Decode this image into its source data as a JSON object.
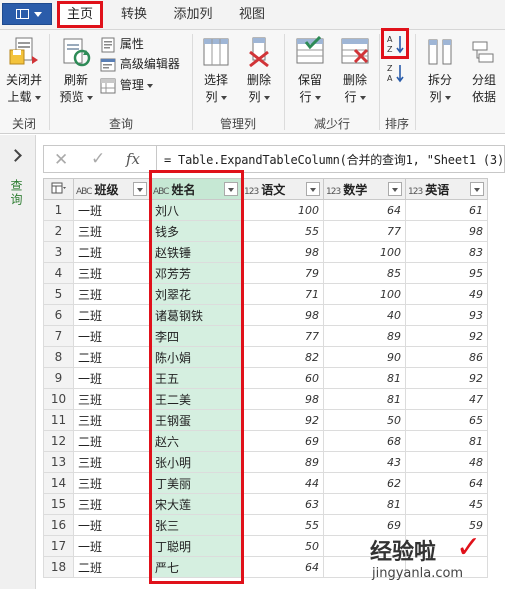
{
  "file_menu": {
    "icon": "menu-icon"
  },
  "tabs": [
    {
      "label": "主页"
    },
    {
      "label": "转换"
    },
    {
      "label": "添加列"
    },
    {
      "label": "视图"
    }
  ],
  "ribbon": {
    "close_load": {
      "line1": "关闭并",
      "line2": "上载"
    },
    "refresh": {
      "line1": "刷新",
      "line2": "预览"
    },
    "properties": "属性",
    "advanced_editor": "高级编辑器",
    "manage": "管理",
    "choose_columns": {
      "line1": "选择",
      "line2": "列"
    },
    "remove_columns": {
      "line1": "删除",
      "line2": "列"
    },
    "keep_rows": {
      "line1": "保留",
      "line2": "行"
    },
    "remove_rows": {
      "line1": "删除",
      "line2": "行"
    },
    "split_column": {
      "line1": "拆分",
      "line2": "列"
    },
    "group_by": {
      "line1": "分组",
      "line2": "依据"
    },
    "groups": {
      "close": "关闭",
      "query": "查询",
      "manage_columns": "管理列",
      "reduce_rows": "减少行",
      "sort": "排序"
    }
  },
  "left_rail": {
    "label": "查询"
  },
  "formula_bar": {
    "cancel": "✕",
    "commit": "✓",
    "fx": "fx",
    "formula": "= Table.ExpandTableColumn(合并的查询1, \"Sheet1 (3)\","
  },
  "table": {
    "columns": [
      {
        "type": "ABC",
        "label": "班级"
      },
      {
        "type": "ABC",
        "label": "姓名"
      },
      {
        "type": "123",
        "label": "语文"
      },
      {
        "type": "123",
        "label": "数学"
      },
      {
        "type": "123",
        "label": "英语"
      }
    ],
    "rows": [
      [
        "1",
        "一班",
        "刘八",
        "100",
        "64",
        "61"
      ],
      [
        "2",
        "三班",
        "钱多",
        "55",
        "77",
        "98"
      ],
      [
        "3",
        "二班",
        "赵铁锤",
        "98",
        "100",
        "83"
      ],
      [
        "4",
        "三班",
        "邓芳芳",
        "79",
        "85",
        "95"
      ],
      [
        "5",
        "三班",
        "刘翠花",
        "71",
        "100",
        "49"
      ],
      [
        "6",
        "二班",
        "诸葛钢铁",
        "98",
        "40",
        "93"
      ],
      [
        "7",
        "一班",
        "李四",
        "77",
        "89",
        "92"
      ],
      [
        "8",
        "二班",
        "陈小娟",
        "82",
        "90",
        "86"
      ],
      [
        "9",
        "一班",
        "王五",
        "60",
        "81",
        "92"
      ],
      [
        "10",
        "三班",
        "王二美",
        "98",
        "81",
        "47"
      ],
      [
        "11",
        "三班",
        "王钢蛋",
        "92",
        "50",
        "65"
      ],
      [
        "12",
        "二班",
        "赵六",
        "69",
        "68",
        "81"
      ],
      [
        "13",
        "三班",
        "张小明",
        "89",
        "43",
        "48"
      ],
      [
        "14",
        "三班",
        "丁美丽",
        "44",
        "62",
        "64"
      ],
      [
        "15",
        "三班",
        "宋大莲",
        "63",
        "81",
        "45"
      ],
      [
        "16",
        "一班",
        "张三",
        "55",
        "69",
        "59"
      ],
      [
        "17",
        "一班",
        "丁聪明",
        "50",
        "",
        ""
      ],
      [
        "18",
        "二班",
        "严七",
        "64",
        "",
        ""
      ]
    ]
  },
  "watermark": {
    "text": "经验啦",
    "check": "✓",
    "url": "jingyanla.com"
  },
  "colors": {
    "highlight_red": "#e0111a",
    "name_column_fill": "#d5efe0",
    "file_button": "#2a5caa",
    "rail_label": "#2e7d32"
  }
}
